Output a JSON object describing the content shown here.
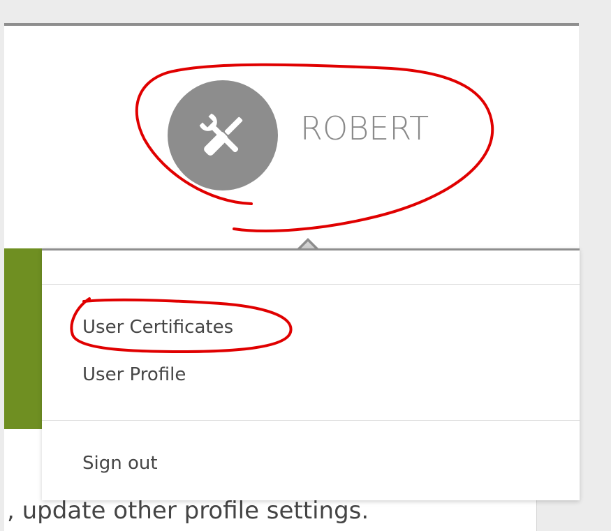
{
  "user": {
    "name": "ROBERT",
    "avatar_icon": "wrench-screwdriver-icon"
  },
  "menu": {
    "items": [
      {
        "label": "User Certificates"
      },
      {
        "label": "User Profile"
      }
    ],
    "sign_out": "Sign out"
  },
  "background": {
    "text": ", update other profile settings."
  },
  "colors": {
    "avatar_bg": "#8d8d8d",
    "accent_green": "#6f8f22",
    "annotation_red": "#e00000",
    "divider_gray": "#8e8e8e"
  }
}
